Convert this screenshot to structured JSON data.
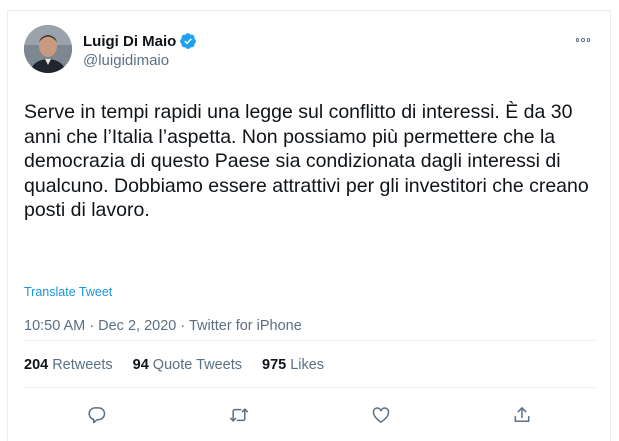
{
  "author": {
    "name": "Luigi Di Maio",
    "handle": "@luigidimaio",
    "verified": true
  },
  "tweet": {
    "text": "Serve in tempi rapidi una legge sul conflitto di interessi. È da 30 anni che l’Italia l’aspetta. Non possiamo più permettere che la democrazia di questo Paese sia condizionata dagli interessi di qualcuno. Dobbiamo essere attrattivi per gli investitori che creano posti di lavoro.",
    "translate_label": "Translate Tweet",
    "meta": "10:50 AM · Dec 2, 2020 · Twitter for iPhone"
  },
  "stats": {
    "retweets_count": "204",
    "retweets_label": "Retweets",
    "quotes_count": "94",
    "quotes_label": "Quote Tweets",
    "likes_count": "975",
    "likes_label": "Likes"
  },
  "actions": {
    "reply_icon": "reply-icon",
    "retweet_icon": "retweet-icon",
    "like_icon": "heart-icon",
    "share_icon": "share-icon"
  },
  "colors": {
    "text": "#0f1419",
    "secondary": "#5b7083",
    "link": "#1b95e0",
    "verified": "#1da1f2",
    "divider": "#e6ecf0"
  }
}
